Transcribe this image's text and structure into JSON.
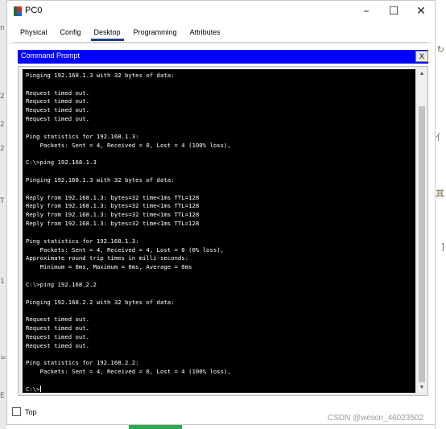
{
  "window": {
    "title": "PC0",
    "controls": {
      "minimize": "–",
      "maximize": "☐",
      "close": "✕"
    }
  },
  "tabs": [
    {
      "label": "Physical",
      "active": false
    },
    {
      "label": "Config",
      "active": false
    },
    {
      "label": "Desktop",
      "active": true
    },
    {
      "label": "Programming",
      "active": false
    },
    {
      "label": "Attributes",
      "active": false
    }
  ],
  "command_prompt": {
    "title": "Command Prompt",
    "close_label": "X",
    "lines": [
      "Pinging 192.168.1.3 with 32 bytes of data:",
      "",
      "Request timed out.",
      "Request timed out.",
      "Request timed out.",
      "Request timed out.",
      "",
      "Ping statistics for 192.168.1.3:",
      "    Packets: Sent = 4, Received = 0, Lost = 4 (100% loss),",
      "",
      "C:\\>ping 192.168.1.3",
      "",
      "Pinging 192.168.1.3 with 32 bytes of data:",
      "",
      "Reply from 192.168.1.3: bytes=32 time<1ms TTL=128",
      "Reply from 192.168.1.3: bytes=32 time<1ms TTL=128",
      "Reply from 192.168.1.3: bytes=32 time<1ms TTL=128",
      "Reply from 192.168.1.3: bytes=32 time<1ms TTL=128",
      "",
      "Ping statistics for 192.168.1.3:",
      "    Packets: Sent = 4, Received = 4, Lost = 0 (0% loss),",
      "Approximate round trip times in milli-seconds:",
      "    Minimum = 0ms, Maximum = 0ms, Average = 0ms",
      "",
      "C:\\>ping 192.168.2.2",
      "",
      "Pinging 192.168.2.2 with 32 bytes of data:",
      "",
      "Request timed out.",
      "Request timed out.",
      "Request timed out.",
      "Request timed out.",
      "",
      "Ping statistics for 192.168.2.2:",
      "    Packets: Sent = 4, Received = 0, Lost = 4 (100% loss),",
      ""
    ],
    "prompt": "C:\\>"
  },
  "footer": {
    "top_label": "Top",
    "top_checked": false,
    "watermark": "CSDN @weixin_46023502"
  },
  "icons": {
    "app": "pc-icon",
    "scroll_up": "▲",
    "scroll_down": "▼"
  },
  "colors": {
    "cmd_bar": "#0000ff",
    "terminal_bg": "#000000",
    "terminal_fg": "#ffffff",
    "active_tab_underline": "#1a3f8f"
  }
}
